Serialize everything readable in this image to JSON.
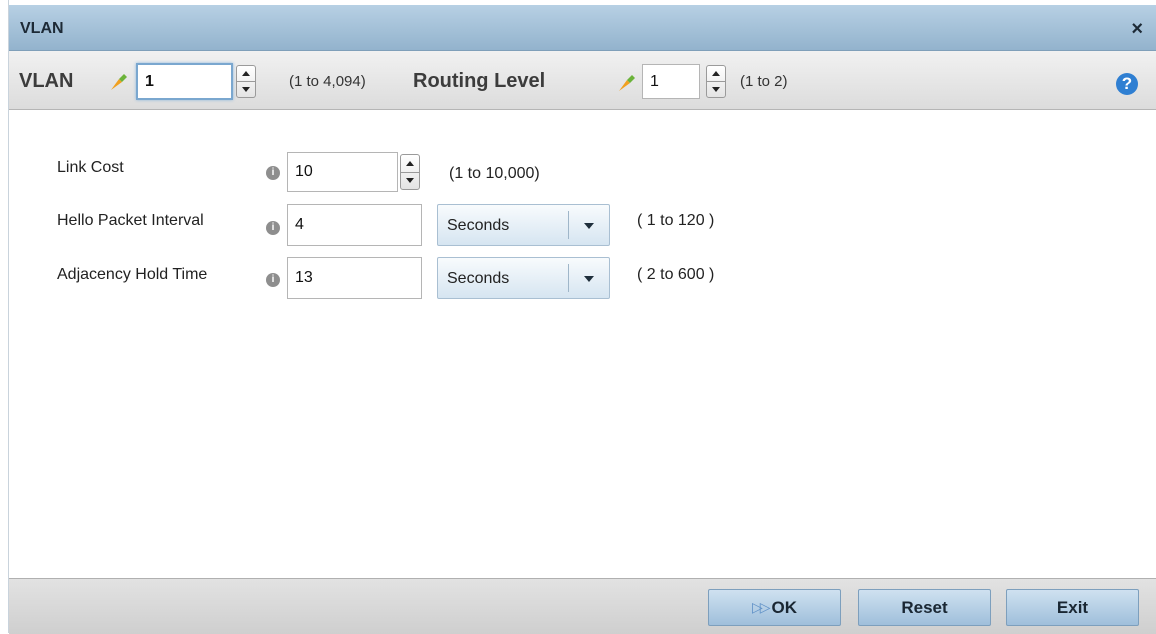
{
  "dialog": {
    "title": "VLAN",
    "close_glyph": "×"
  },
  "header": {
    "vlan_label": "VLAN",
    "vlan_value": "1",
    "vlan_range": "(1 to 4,094)",
    "routing_label": "Routing Level",
    "routing_value": "1",
    "routing_range": "(1 to 2)",
    "help_glyph": "?"
  },
  "form": {
    "link_cost": {
      "label": "Link Cost",
      "value": "10",
      "range": "(1 to 10,000)"
    },
    "hello_interval": {
      "label": "Hello Packet Interval",
      "value": "4",
      "unit": "Seconds",
      "range": "( 1 to 120 )"
    },
    "adjacency_hold": {
      "label": "Adjacency Hold Time",
      "value": "13",
      "unit": "Seconds",
      "range": "( 2 to 600 )"
    },
    "info_glyph": "i"
  },
  "footer": {
    "ok_label": "OK",
    "reset_label": "Reset",
    "exit_label": "Exit"
  },
  "colors": {
    "title_bar": "#a6c3da",
    "help_icon": "#2f7fd2",
    "button": "#b7d0e6"
  },
  "icons": [
    "change-indicator-icon",
    "spinner-up-icon",
    "spinner-down-icon",
    "help-icon",
    "info-icon",
    "dropdown-arrow-icon",
    "ok-arrow-icon",
    "close-icon"
  ]
}
